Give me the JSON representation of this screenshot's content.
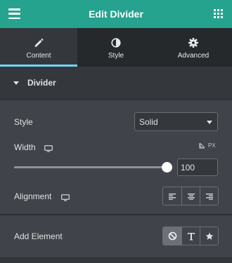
{
  "header": {
    "title": "Edit Divider",
    "menu_icon": "hamburger-menu-icon",
    "apps_icon": "grid-icon",
    "brand_color": "#26a38f"
  },
  "tabs": [
    {
      "label": "Content",
      "icon": "pencil-icon",
      "active": true
    },
    {
      "label": "Style",
      "icon": "half-circle-icon",
      "active": false
    },
    {
      "label": "Advanced",
      "icon": "gear-icon",
      "active": false
    }
  ],
  "accent_color": "#71d7f7",
  "section": {
    "title": "Divider",
    "icon": "caret-down-icon"
  },
  "controls": {
    "style": {
      "label": "Style",
      "value": "Solid"
    },
    "width": {
      "label": "Width",
      "unit": "PX",
      "value": "100",
      "slider_fraction": 1.0
    },
    "alignment": {
      "label": "Alignment",
      "options": [
        "align-left-icon",
        "align-center-icon",
        "align-right-icon"
      ],
      "selected": null
    },
    "add_element": {
      "label": "Add Element",
      "options": [
        "none-icon",
        "text-icon",
        "star-icon"
      ],
      "selected": "none-icon"
    }
  }
}
